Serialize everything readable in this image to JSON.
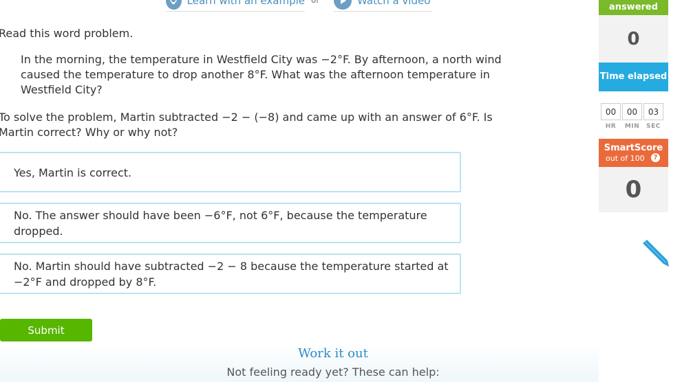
{
  "help_links": {
    "learn_label": "Learn with an example",
    "or_label": "or",
    "video_label": "Watch a video"
  },
  "question": {
    "instruction": "Read this word problem.",
    "problem": "In the morning, the temperature in Westfield City was −2°F. By afternoon, a north wind caused the temperature to drop another 8°F. What was the afternoon temperature in Westfield City?",
    "prompt": "To solve the problem, Martin subtracted −2 − (−8) and came up with an answer of 6°F. Is Martin correct? Why or why not?",
    "choices": [
      "Yes, Martin is correct.",
      "No. The answer should have been −6°F, not 6°F, because the temperature dropped.",
      "No. Martin should have subtracted −2 − 8 because the temperature started at −2°F and dropped by 8°F."
    ],
    "submit_label": "Submit"
  },
  "footer": {
    "work_it_out": "Work it out",
    "not_ready": "Not feeling ready yet? These can help:"
  },
  "sidebar": {
    "answered_label": "answered",
    "answered_value": "0",
    "time_label": "Time elapsed",
    "timer": {
      "hr": "00",
      "min": "00",
      "sec": "03"
    },
    "timer_labels": {
      "hr": "HR",
      "min": "MIN",
      "sec": "SEC"
    },
    "smartscore_title": "SmartScore",
    "smartscore_sub": "out of 100",
    "smartscore_value": "0"
  },
  "colors": {
    "submit_green": "#56b600",
    "choice_border": "#b9e3f3",
    "time_blue": "#25abe0",
    "smartscore_orange": "#e96b3c",
    "answered_green": "#7ab929"
  },
  "icons": [
    "lightbulb-icon",
    "play-icon",
    "help-question-icon",
    "pencil-icon"
  ]
}
